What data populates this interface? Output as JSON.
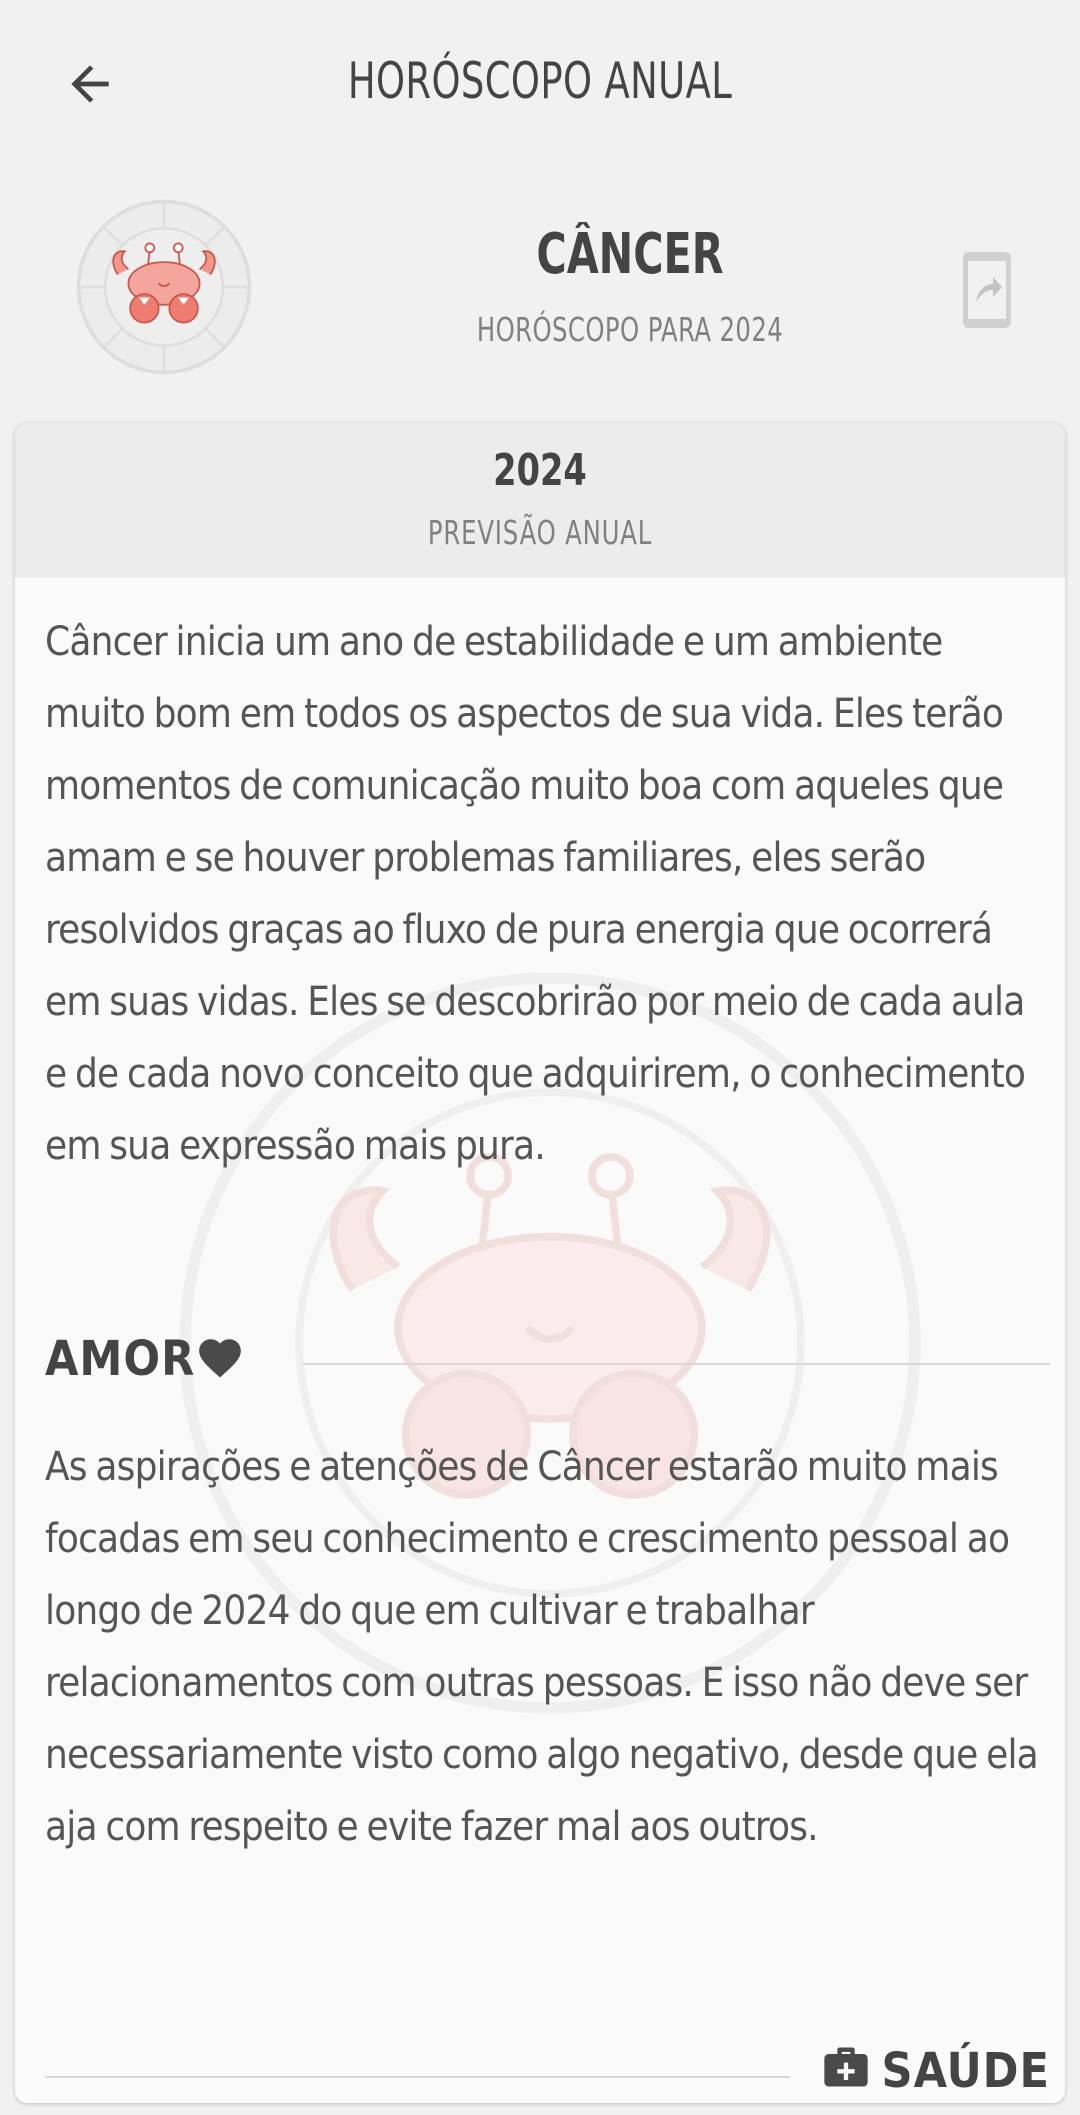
{
  "appbar": {
    "title": "HORÓSCOPO ANUAL",
    "back_icon": "arrow-left-icon"
  },
  "header": {
    "sign_name": "CÂNCER",
    "subtitle": "HORÓSCOPO PARA 2024",
    "emblem_icon": "cancer-crab-zodiac-emblem",
    "share_icon": "share-icon"
  },
  "card": {
    "year": "2024",
    "subtitle": "PREVISÃO ANUAL",
    "intro": "Câncer inicia um ano de estabilidade e um ambiente muito bom em todos os aspectos de sua vida. Eles terão momentos de comunicação muito boa com aqueles que amam e se houver problemas familiares, eles serão resolvidos graças ao fluxo de pura energia que ocorrerá em suas vidas. Eles se descobrirão por meio de cada aula e de cada novo conceito que adquirirem, o conhecimento em sua expressão mais pura.",
    "sections": [
      {
        "title": "AMOR",
        "icon": "heart-icon",
        "text": "As aspirações e atenções de Câncer estarão muito mais focadas em seu conhecimento e crescimento pessoal ao longo de 2024 do que em cultivar e trabalhar relacionamentos com outras pessoas. E isso não deve ser necessariamente visto como algo negativo, desde que ela aja com respeito e evite fazer mal aos outros."
      },
      {
        "title": "SAÚDE",
        "icon": "first-aid-kit-icon"
      }
    ]
  },
  "colors": {
    "background": "#f1f1f1",
    "card": "#fafafa",
    "card_header": "#ececec",
    "text": "#555555",
    "crab": "#e8786c"
  }
}
